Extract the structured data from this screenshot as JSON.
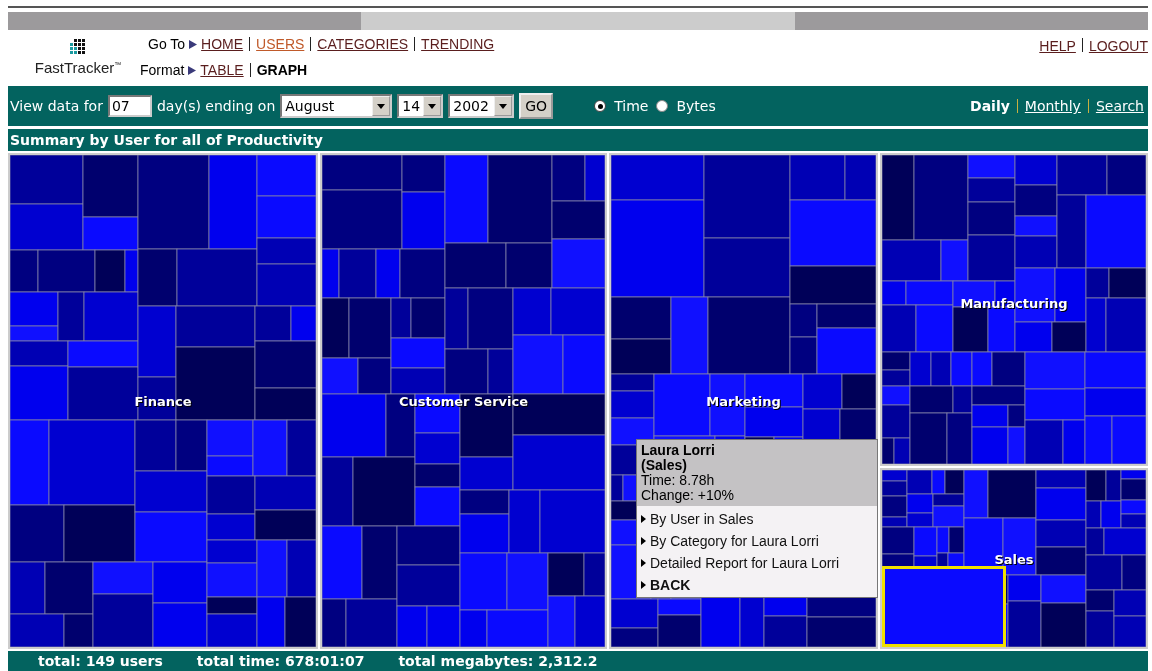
{
  "logo": {
    "name": "FastTracker",
    "mark": "™"
  },
  "nav": {
    "label": "Go To",
    "links": [
      {
        "label": "HOME",
        "selected": false
      },
      {
        "label": "USERS",
        "selected": true
      },
      {
        "label": "CATEGORIES",
        "selected": false
      },
      {
        "label": "TRENDING",
        "selected": false
      }
    ]
  },
  "format": {
    "label": "Format",
    "options": [
      {
        "label": "TABLE",
        "selected": false
      },
      {
        "label": "GRAPH",
        "selected": true
      }
    ]
  },
  "account_links": [
    "HELP",
    "LOGOUT"
  ],
  "filter": {
    "prefix": "View data for",
    "days": "07",
    "middle": "day(s) ending on",
    "month": "August",
    "day": "14",
    "year": "2002",
    "go": "GO",
    "measures": [
      {
        "label": "Time",
        "selected": true
      },
      {
        "label": "Bytes",
        "selected": false
      }
    ]
  },
  "periods": [
    {
      "label": "Daily",
      "selected": true
    },
    {
      "label": "Monthly",
      "selected": false
    },
    {
      "label": "Search",
      "selected": false
    }
  ],
  "summary_title": "Summary by User for all of Productivity",
  "treemap": {
    "groups": [
      {
        "label": "Finance",
        "highlighted": false
      },
      {
        "label": "Customer Service",
        "highlighted": false
      },
      {
        "label": "Marketing",
        "highlighted": false
      },
      {
        "label": "Manufacturing",
        "highlighted": false
      },
      {
        "label": "Sales",
        "highlighted": true
      }
    ]
  },
  "tooltip": {
    "name": "Laura Lorri",
    "group": "(Sales)",
    "time": "Time: 8.78h",
    "change": "Change: +10%",
    "actions": [
      {
        "label": "By User in Sales",
        "bold": false
      },
      {
        "label": "By Category for Laura Lorri",
        "bold": false
      },
      {
        "label": "Detailed Report for Laura Lorri",
        "bold": false
      },
      {
        "label": "BACK",
        "bold": true
      }
    ]
  },
  "totals": [
    "total: 149 users",
    "total time: 678:01:07",
    "total megabytes: 2,312.2"
  ]
}
